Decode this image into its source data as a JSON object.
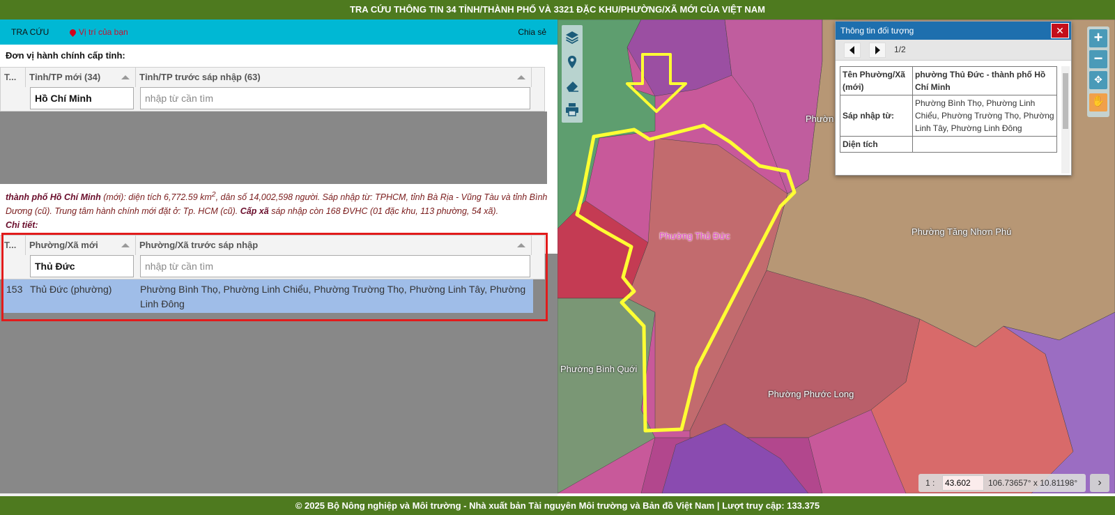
{
  "title_bar": "TRA CỨU THÔNG TIN 34 TỈNH/THÀNH PHỐ VÀ 3321 ĐẶC KHU/PHƯỜNG/XÃ MỚI CỦA VIỆT NAM",
  "nav": {
    "search": "TRA CỨU",
    "location": "Vị trí của bạn",
    "share": "Chia sẻ"
  },
  "province": {
    "label": "Đơn vị hành chính cấp tỉnh:",
    "col_stt": "T...",
    "col_new": "Tỉnh/TP mới (34)",
    "col_old": "Tỉnh/TP trước sáp nhập (63)",
    "filter_new": "Hồ Chí Minh",
    "filter_old_placeholder": "nhập từ cần tìm"
  },
  "info": {
    "city": "thành phố Hồ Chí Minh",
    "t1": " (mới): diện tích 6,772.59 km",
    "sup": "2",
    "t2": ", dân số 14,002,598 người. Sáp nhập từ: TPHCM, tỉnh Bà Rịa - Vũng Tàu và tỉnh Bình Dương (cũ). Trung tâm hành chính mới đặt ở: Tp. HCM (cũ). ",
    "cap_xa": "Cấp xã",
    "t3": " sáp nhập còn 168 ĐVHC (01 đặc khu, 113 phường, 54 xã).",
    "detail": "Chi tiết:"
  },
  "ward": {
    "col_stt": "T...",
    "col_new": "Phường/Xã mới",
    "col_old": "Phường/Xã trước sáp nhập",
    "filter_new": "Thủ Đức",
    "filter_old_placeholder": "nhập từ cần tìm",
    "row": {
      "stt": "153",
      "new": "Thủ Đức (phường)",
      "old": "Phường Bình Thọ, Phường Linh Chiểu, Phường Trường Thọ, Phường Linh Tây, Phường Linh Đông"
    }
  },
  "map_labels": {
    "thu_duc": "Phường Thủ Đức",
    "tang_nhon_phu": "Phường Tăng Nhơn Phú",
    "binh_quoi": "Phường Bình Quới",
    "phuoc_long": "Phường Phước Long",
    "top_partial": "Phườn"
  },
  "popup": {
    "title": "Thông tin đối tượng",
    "close": "✕",
    "count": "1/2",
    "rows": [
      {
        "k": "Tên Phường/Xã (mới)",
        "v": "phường Thủ Đức - thành phố Hồ Chí Minh"
      },
      {
        "k": "Sáp nhập từ:",
        "v": " Phường Bình Thọ, Phường Linh Chiểu, Phường Trường Thọ, Phường Linh Tây, Phường Linh Đông"
      },
      {
        "k": "Diện tích",
        "v": ""
      }
    ]
  },
  "scale": {
    "prefix": "1 :",
    "value": "43.602",
    "coords": "106.73657° x 10.81198°"
  },
  "footer": "© 2025  Bộ Nông nghiệp và Môi trường - Nhà xuất bản Tài nguyên Môi trường và Bản đồ Việt Nam | Lượt truy cập: 133.375",
  "colors": {
    "title_bg": "#4e7a1f",
    "nav_bg": "#00b8d4",
    "selection_row": "#9fbde8",
    "highlight_border": "#e21b1b",
    "ward_outline": "#ffff33"
  }
}
